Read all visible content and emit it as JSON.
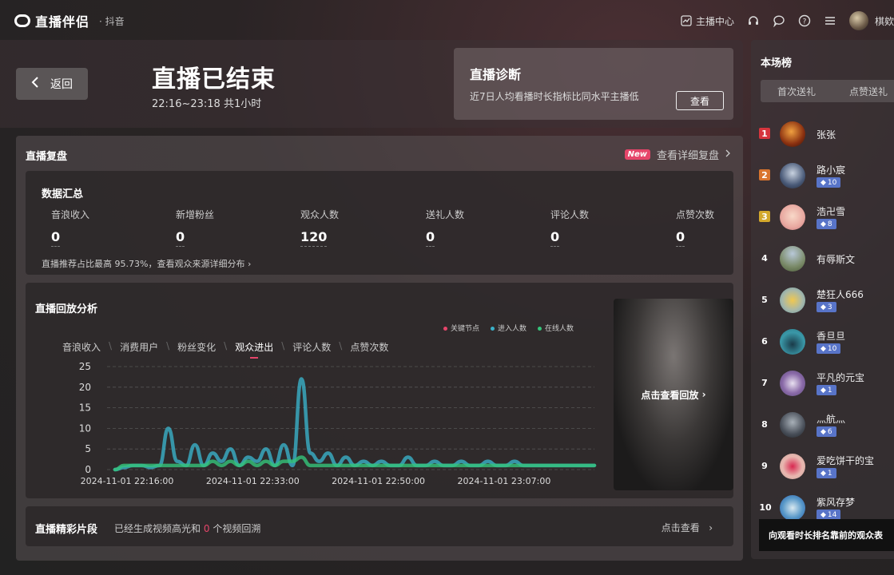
{
  "app": {
    "logo_text": "直播伴侣",
    "logo_sub": "· 抖音"
  },
  "topbar": {
    "anchor_center": "主播中心",
    "user_name": "棋欸"
  },
  "header": {
    "back_label": "返回",
    "title": "直播已结束",
    "subtitle": "22:16~23:18 共1小时",
    "diagnosis": {
      "title": "直播诊断",
      "desc": "近7日人均看播时长指标比同水平主播低",
      "button": "查看"
    }
  },
  "replay": {
    "title": "直播复盘",
    "new_badge": "New",
    "detail_link": "查看详细复盘",
    "summary": {
      "title": "数据汇总",
      "stats": [
        {
          "label": "音浪收入",
          "value": "0"
        },
        {
          "label": "新增粉丝",
          "value": "0"
        },
        {
          "label": "观众人数",
          "value": "120"
        },
        {
          "label": "送礼人数",
          "value": "0"
        },
        {
          "label": "评论人数",
          "value": "0"
        },
        {
          "label": "点赞次数",
          "value": "0"
        }
      ],
      "note": "直播推荐占比最高 95.73%，查看观众来源详细分布"
    },
    "analysis": {
      "title": "直播回放分析",
      "legend": [
        "关键节点",
        "进入人数",
        "在线人数"
      ],
      "legend_colors": [
        "#e6456a",
        "#3ab0c8",
        "#35c47a"
      ],
      "tabs": [
        "音浪收入",
        "消费用户",
        "粉丝变化",
        "观众进出",
        "评论人数",
        "点赞次数"
      ],
      "active_tab": "观众进出",
      "video_label": "点击查看回放"
    },
    "clips": {
      "title": "直播精彩片段",
      "desc_prefix": "已经生成视频高光和",
      "count": "0",
      "desc_suffix": "个视频回溯",
      "link": "点击查看"
    }
  },
  "chart_data": {
    "type": "line",
    "x_ticks": [
      "2024-11-01 22:16:00",
      "2024-11-01 22:33:00",
      "2024-11-01 22:50:00",
      "2024-11-01 23:07:00"
    ],
    "ylim": [
      0,
      25
    ],
    "y_ticks": [
      0,
      5,
      10,
      15,
      20,
      25
    ],
    "grid": true,
    "legend_position": "top-right",
    "series": [
      {
        "name": "进入人数",
        "color": "#3ab0c8",
        "values": [
          0,
          0.5,
          1,
          1,
          0.5,
          1,
          10,
          2,
          1,
          6,
          1,
          4,
          2,
          5,
          1,
          3,
          2,
          5,
          1,
          6,
          1,
          22,
          4,
          2,
          4,
          1,
          3,
          1,
          2,
          1,
          2,
          1,
          1,
          3,
          1,
          1,
          2,
          1,
          1,
          2,
          1,
          1,
          2,
          1,
          1,
          2,
          1,
          1,
          1,
          1,
          1,
          1,
          1,
          1,
          1
        ]
      },
      {
        "name": "在线人数",
        "color": "#35c47a",
        "values": [
          0,
          1,
          1,
          1,
          1,
          1,
          1,
          1,
          1,
          1,
          1,
          2,
          1,
          2,
          1,
          2,
          1,
          2,
          1,
          2,
          2,
          3,
          1,
          1,
          1,
          1,
          1,
          1,
          1,
          1,
          1,
          1,
          1,
          1,
          1,
          1,
          1,
          1,
          1,
          1,
          1,
          1,
          1,
          1,
          1,
          1,
          1,
          1,
          1,
          1,
          1,
          1,
          1,
          1,
          1
        ]
      }
    ]
  },
  "leaderboard": {
    "title": "本场榜",
    "tabs": [
      "首次送礼",
      "点赞送礼"
    ],
    "rows": [
      {
        "rank": "1",
        "name": "张张",
        "badge": "",
        "rank_color": "#d6353d"
      },
      {
        "rank": "2",
        "name": "路小宸",
        "badge": "10",
        "rank_color": "#d9742e"
      },
      {
        "rank": "3",
        "name": "浩卍雪",
        "badge": "8",
        "rank_color": "#d3a82c"
      },
      {
        "rank": "4",
        "name": "有辱斯文",
        "badge": "",
        "rank_color": ""
      },
      {
        "rank": "5",
        "name": "楚狂人666",
        "badge": "3",
        "rank_color": ""
      },
      {
        "rank": "6",
        "name": "香旦旦",
        "badge": "10",
        "rank_color": ""
      },
      {
        "rank": "7",
        "name": "平凡的元宝",
        "badge": "1",
        "rank_color": ""
      },
      {
        "rank": "8",
        "name": "灬航灬",
        "badge": "6",
        "rank_color": ""
      },
      {
        "rank": "9",
        "name": "爱吃饼干的宝",
        "badge": "1",
        "rank_color": ""
      },
      {
        "rank": "10",
        "name": "紫风存梦",
        "badge": "14",
        "rank_color": ""
      }
    ],
    "tooltip": "向观看时长排名靠前的观众表"
  }
}
